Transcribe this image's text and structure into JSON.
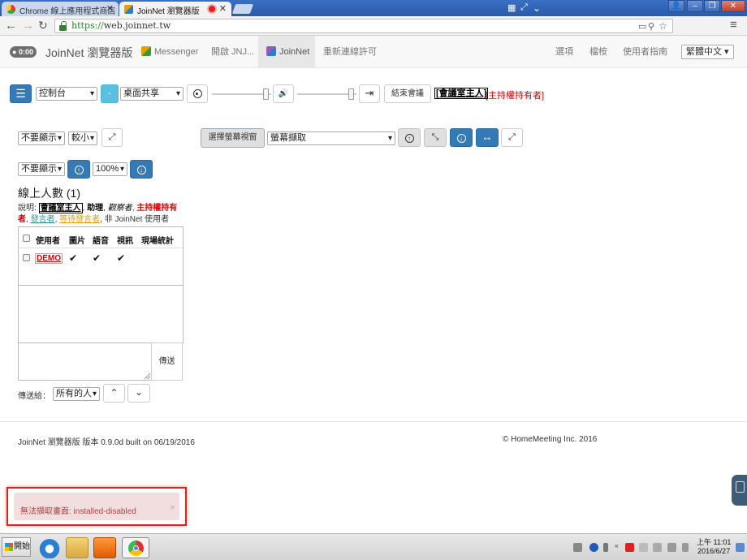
{
  "browser": {
    "tabs": [
      {
        "label": "Chrome 線上應用程式商店"
      },
      {
        "label": "JoinNet 瀏覽器版"
      }
    ],
    "url_scheme": "https://",
    "url_host": "web.joinnet.tw"
  },
  "app": {
    "badge": "0:00",
    "brand": "JoinNet 瀏覽器版",
    "nav": [
      {
        "label": "Messenger"
      },
      {
        "label": "開啟 JNJ..."
      },
      {
        "label": "JoinNet"
      },
      {
        "label": "重新連線許可"
      }
    ],
    "right_nav": [
      {
        "label": "選項"
      },
      {
        "label": "檔桉"
      },
      {
        "label": "使用者指南"
      }
    ],
    "language": "繁體中文"
  },
  "controls": {
    "console_select": "控制台",
    "minus_label": "-",
    "share_select": "桌面共享",
    "end_meeting": "結束會議",
    "moderator_label": "[會議室主人]",
    "host_label": "[主持權持有者]"
  },
  "display": {
    "row1_show": "不要顯示",
    "row1_size": "較小",
    "select_screen_button": "選擇螢幕視窗",
    "screen_capture_select": "螢幕擷取",
    "row2_show": "不要顯示",
    "zoom": "100%"
  },
  "online": {
    "title": "線上人數 (1)",
    "legend": {
      "prefix": "說明: ",
      "moderator": "會議室主人",
      "sep1": ", ",
      "assistant": "助理",
      "sep2": ", ",
      "observer": "觀察者",
      "sep3": ", ",
      "host": "主持權持有者",
      "sep4": ", ",
      "speaker": "發言者",
      "sep5": ", ",
      "waiting": "等待發言者",
      "suffix": ", 非 JoinNet 使用者"
    },
    "columns": [
      "使用者",
      "圖片",
      "語音",
      "視訊",
      "現場統計"
    ],
    "users": [
      {
        "name": "DEMO",
        "tick": "✔"
      }
    ]
  },
  "chat": {
    "send_label": "傳送",
    "send_to_label": "傳送給：",
    "recipient": "所有的人"
  },
  "footer": {
    "version": "JoinNet 瀏覽器版 版本 0.9.0d built on 06/19/2016",
    "copyright": "© HomeMeeting Inc. 2016"
  },
  "alert": {
    "text": "無法擷取畫面: installed-disabled",
    "close": "×"
  },
  "taskbar": {
    "start": "開始",
    "time": "上午 11:01",
    "date": "2016/6/27"
  },
  "colors": {
    "primary": "#337ab7",
    "info": "#5bc0de",
    "danger": "#d9251c",
    "host_red": "#e00000"
  }
}
